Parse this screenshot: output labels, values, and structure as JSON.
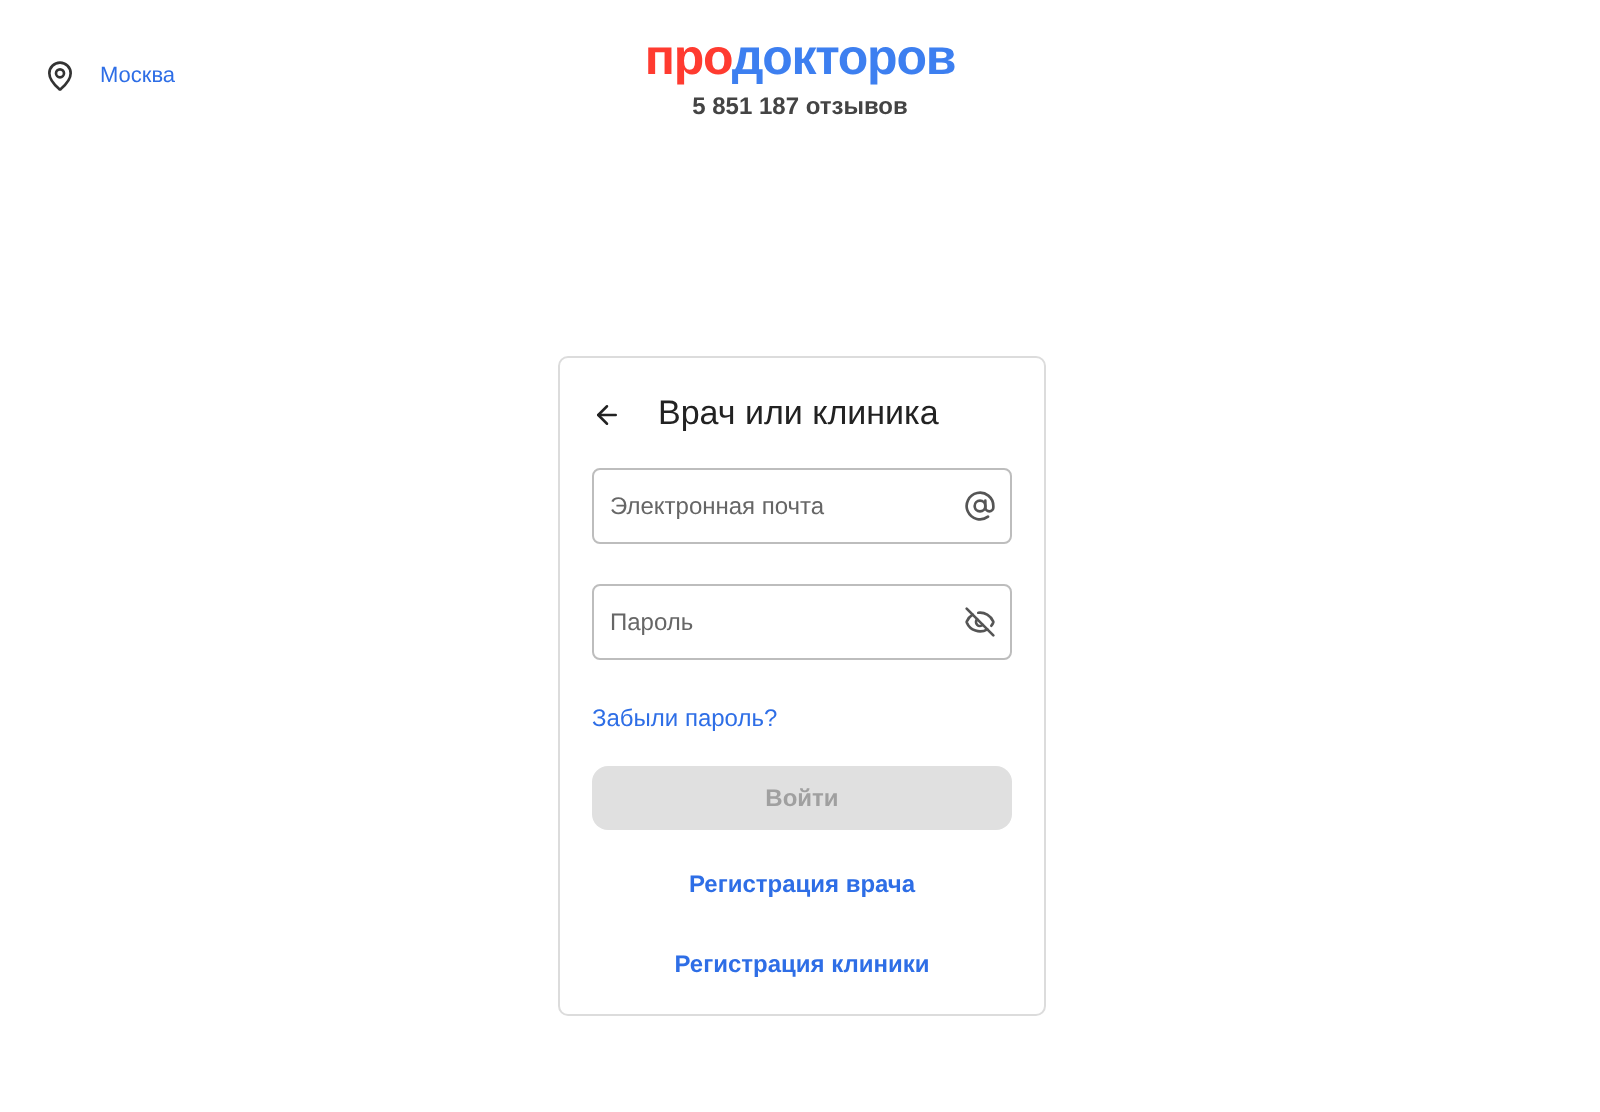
{
  "header": {
    "city": "Москва",
    "logo": {
      "prefix": "про",
      "name": "докторов"
    },
    "reviews": "5 851 187 отзывов"
  },
  "card": {
    "title": "Врач или клиника",
    "fields": [
      {
        "kind": "email",
        "placeholder": "Электронная почта"
      },
      {
        "kind": "password",
        "placeholder": "Пароль"
      }
    ],
    "forgot_link": "Забыли пароль?",
    "submit": {
      "label": "Войти",
      "disabled": true
    },
    "links": [
      "Регистрация врача",
      "Регистрация клиники"
    ]
  }
}
